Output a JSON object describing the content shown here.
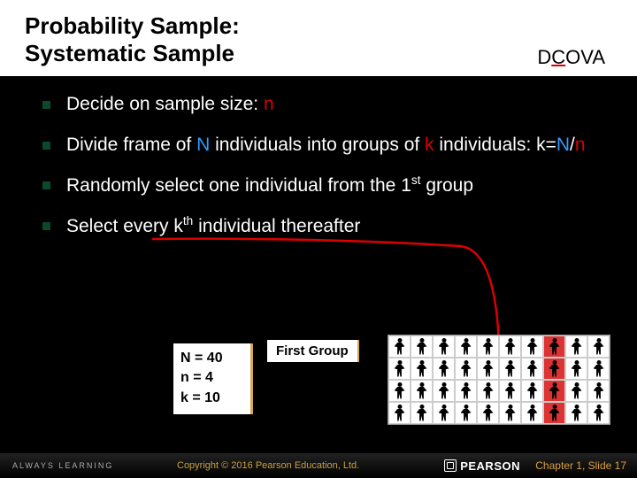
{
  "title_line1": "Probability Sample:",
  "title_line2": "Systematic Sample",
  "dcova": {
    "pre": "D",
    "underlined": "C",
    "post": "OVA"
  },
  "bullets": {
    "b1_a": "Decide on sample size: ",
    "b1_n": "n",
    "b2_a": "Divide frame of ",
    "b2_N": "N",
    "b2_b": " individuals into groups of ",
    "b2_k": "k",
    "b2_c": " individuals:  k=",
    "b2_N2": "N",
    "b2_slash": "/",
    "b2_n": "n",
    "b3_a": "Randomly select one individual from the 1",
    "b3_sup": "st",
    "b3_b": " group",
    "b4_a": "Select every k",
    "b4_sup": "th",
    "b4_b": " individual thereafter"
  },
  "params": {
    "line1": "N = 40",
    "line2": "n = 4",
    "line3": "k = 10"
  },
  "first_group": "First Group",
  "footer": {
    "always": "ALWAYS LEARNING",
    "copyright": "Copyright © 2016 Pearson Education, Ltd.",
    "pearson": "PEARSON",
    "slide": "Chapter 1, Slide 17"
  },
  "grid": {
    "rows": 4,
    "cols": 10,
    "selected_col": 7
  }
}
